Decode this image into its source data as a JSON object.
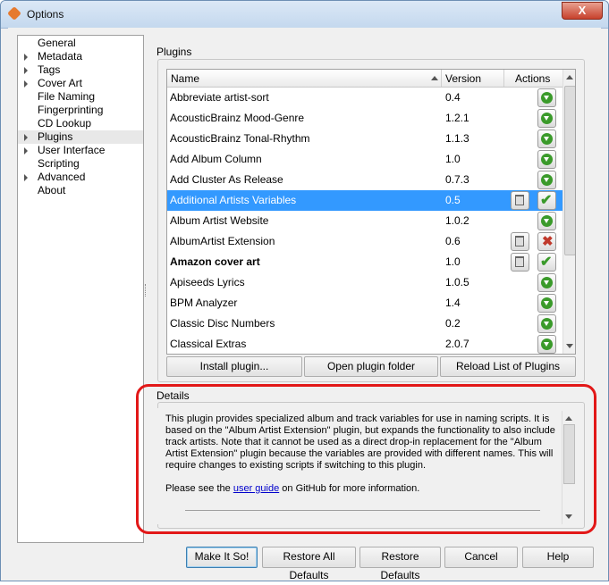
{
  "window": {
    "title": "Options",
    "close_glyph": "X"
  },
  "sidebar": {
    "items": [
      {
        "label": "General",
        "expandable": false
      },
      {
        "label": "Metadata",
        "expandable": true
      },
      {
        "label": "Tags",
        "expandable": true
      },
      {
        "label": "Cover Art",
        "expandable": true
      },
      {
        "label": "File Naming",
        "expandable": false
      },
      {
        "label": "Fingerprinting",
        "expandable": false
      },
      {
        "label": "CD Lookup",
        "expandable": false
      },
      {
        "label": "Plugins",
        "expandable": true,
        "selected": true
      },
      {
        "label": "User Interface",
        "expandable": true
      },
      {
        "label": "Scripting",
        "expandable": false
      },
      {
        "label": "Advanced",
        "expandable": true
      },
      {
        "label": "About",
        "expandable": false
      }
    ]
  },
  "plugins": {
    "group_label": "Plugins",
    "columns": {
      "name": "Name",
      "version": "Version",
      "actions": "Actions"
    },
    "rows": [
      {
        "name": "Abbreviate artist-sort",
        "version": "0.4",
        "state": "available"
      },
      {
        "name": "AcousticBrainz Mood-Genre",
        "version": "1.2.1",
        "state": "available"
      },
      {
        "name": "AcousticBrainz Tonal-Rhythm",
        "version": "1.1.3",
        "state": "available"
      },
      {
        "name": "Add Album Column",
        "version": "1.0",
        "state": "available"
      },
      {
        "name": "Add Cluster As Release",
        "version": "0.7.3",
        "state": "available"
      },
      {
        "name": "Additional Artists Variables",
        "version": "0.5",
        "state": "enabled",
        "selected": true
      },
      {
        "name": "Album Artist Website",
        "version": "1.0.2",
        "state": "available"
      },
      {
        "name": "AlbumArtist Extension",
        "version": "0.6",
        "state": "disabled"
      },
      {
        "name": "Amazon cover art",
        "version": "1.0",
        "state": "enabled",
        "bold": true
      },
      {
        "name": "Apiseeds Lyrics",
        "version": "1.0.5",
        "state": "available"
      },
      {
        "name": "BPM Analyzer",
        "version": "1.4",
        "state": "available"
      },
      {
        "name": "Classic Disc Numbers",
        "version": "0.2",
        "state": "available"
      },
      {
        "name": "Classical Extras",
        "version": "2.0.7",
        "state": "available"
      }
    ],
    "buttons": {
      "install": "Install plugin...",
      "open_folder": "Open plugin folder",
      "reload": "Reload List of Plugins"
    }
  },
  "details": {
    "group_label": "Details",
    "paragraph1": "This plugin provides specialized album and track variables for use in naming scripts. It is based on the \"Album Artist Extension\" plugin, but expands the functionality to also include track artists. Note that it cannot be used as a direct drop-in replacement for the \"Album Artist Extension\" plugin because the variables are provided with different names. This will require changes to existing scripts if switching to this plugin.",
    "p2_before": "Please see the ",
    "p2_link": "user guide",
    "p2_after": " on GitHub for more information."
  },
  "footer": {
    "make_it_so": "Make It So!",
    "restore_all": "Restore All Defaults",
    "restore": "Restore Defaults",
    "cancel": "Cancel",
    "help": "Help"
  },
  "colors": {
    "selection": "#3399ff",
    "highlight_outline": "#e21818",
    "download_green": "#3a9a2a"
  }
}
